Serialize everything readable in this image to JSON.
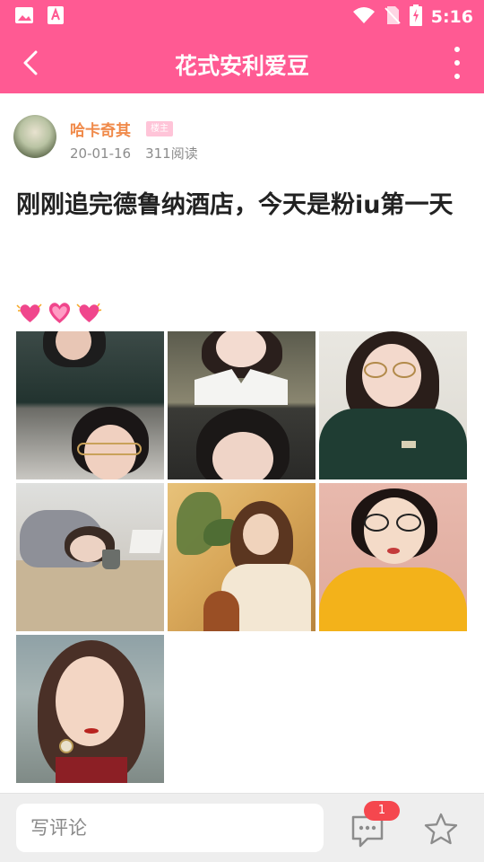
{
  "colors": {
    "brand": "#ff5a93",
    "author_name": "#f08a4a",
    "badge_bg": "#ffc4d8",
    "notification_badge": "#f5474e"
  },
  "status_bar": {
    "time": "5:16",
    "left_icons": [
      "image-icon",
      "app-store-icon"
    ],
    "right_icons": [
      "wifi-icon",
      "no-sim-icon",
      "battery-charging-icon"
    ]
  },
  "app_bar": {
    "title": "花式安利爱豆",
    "back_icon": "back-arrow-icon",
    "more_icon": "more-vertical-icon"
  },
  "post": {
    "author": {
      "name": "哈卡奇其",
      "badge": "楼主"
    },
    "date": "20-01-16",
    "views": "311阅读",
    "title": "刚刚追完德鲁纳酒店，今天是粉iu第一天",
    "emoji": [
      "pink-heart-icon",
      "pink-heart-icon",
      "pink-heart-icon"
    ],
    "photo_count": 7
  },
  "bottom_bar": {
    "comment_placeholder": "写评论",
    "comment_count": "1",
    "comment_icon": "comment-bubble-icon",
    "favorite_icon": "star-icon"
  }
}
